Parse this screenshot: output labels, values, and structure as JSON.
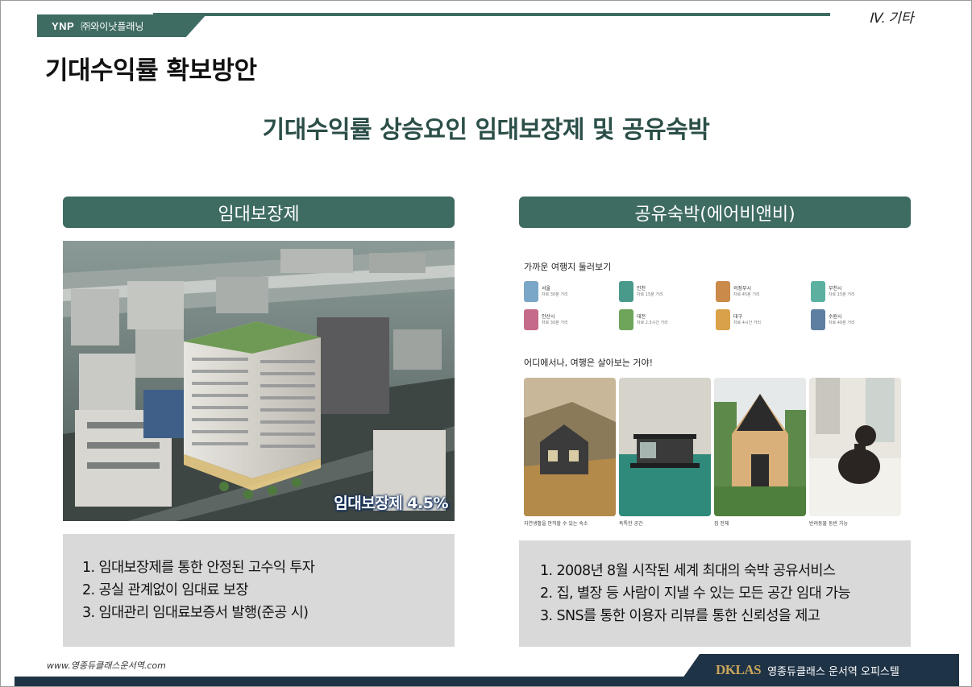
{
  "header": {
    "logo_text": "YNP",
    "company": "㈜와이낫플래닝",
    "section_tag": "Ⅳ. 기타"
  },
  "page_title": "기대수익률 확보방안",
  "subtitle": "기대수익률 상승요인 임대보장제 및 공유숙박",
  "left": {
    "header": "임대보장제",
    "badge": "임대보장제 4.5%",
    "points": [
      "1. 임대보장제를 통한 안정된 고수익 투자",
      "2. 공실 관계없이 임대료 보장",
      "3. 임대관리 임대료보증서 발행(준공 시)"
    ]
  },
  "right": {
    "header": "공유숙박(에어비앤비)",
    "nearby_title": "가까운 여행지 둘러보기",
    "destinations": [
      {
        "name": "서울",
        "dist": "차로 30분 거리",
        "color": "#7aa7c7"
      },
      {
        "name": "인천",
        "dist": "차로 15분 거리",
        "color": "#4a9a8c"
      },
      {
        "name": "의정부시",
        "dist": "차로 45분 거리",
        "color": "#c98a4a"
      },
      {
        "name": "부천시",
        "dist": "차로 15분 거리",
        "color": "#5bb0a0"
      },
      {
        "name": "안산시",
        "dist": "차로 30분 거리",
        "color": "#c56a8a"
      },
      {
        "name": "대전",
        "dist": "차로 2.5시간 거리",
        "color": "#6fa55a"
      },
      {
        "name": "대구",
        "dist": "차로 4시간 거리",
        "color": "#d9a14a"
      },
      {
        "name": "수원시",
        "dist": "차로 40분 거리",
        "color": "#5e7fa0"
      }
    ],
    "anywhere_title": "어디에서나, 여행은 살아보는 거야!",
    "photos": [
      {
        "caption": "자연생활을 만끽할 수 있는 숙소"
      },
      {
        "caption": "독특한 공간"
      },
      {
        "caption": "집 전체"
      },
      {
        "caption": "반려동물 동반 가능"
      }
    ],
    "points": [
      "1. 2008년 8월 시작된 세계 최대의 숙박 공유서비스",
      "2. 집, 별장 등 사람이 지낼 수 있는 모든 공간 임대 가능",
      "3.  SNS를 통한 이용자 리뷰를 통한 신뢰성을 제고"
    ]
  },
  "footer": {
    "url": "www.영종듀클래스운서역.com",
    "logo": "DKLAS",
    "name": "영종듀클래스 운서역 오피스텔"
  },
  "colors": {
    "primary": "#3e6b62",
    "footer": "#1f3346",
    "box": "#d9d9d9"
  }
}
